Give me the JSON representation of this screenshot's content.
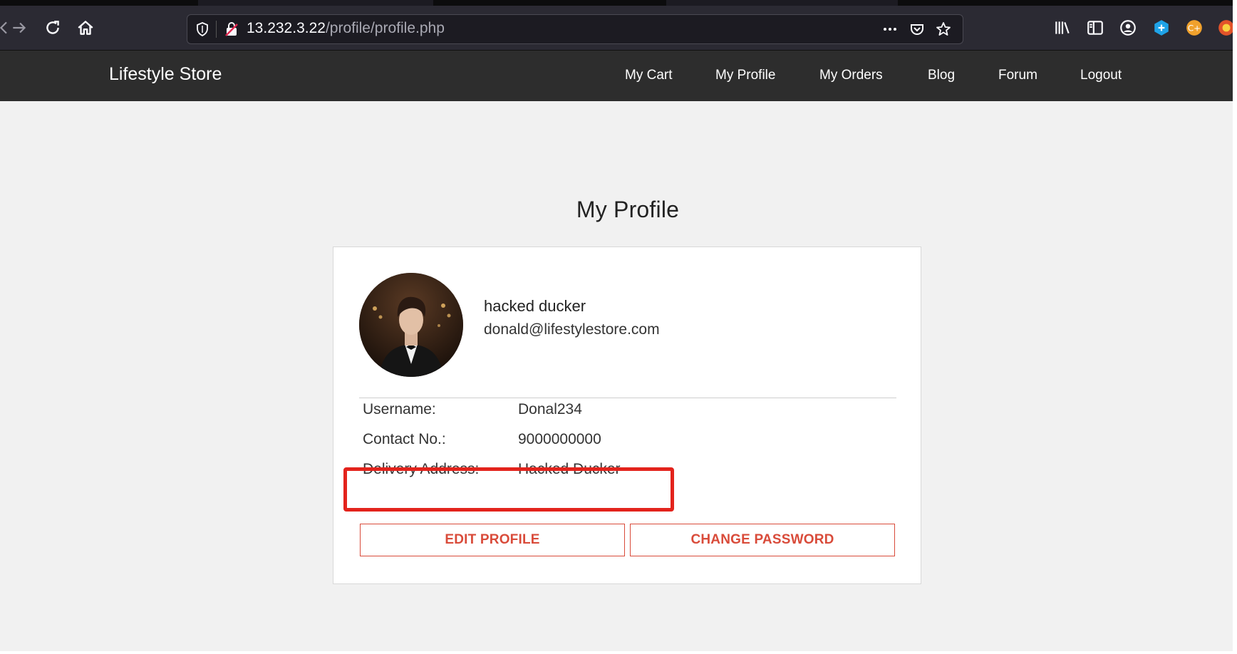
{
  "browser": {
    "url_host": "13.232.3.22",
    "url_path": "/profile/profile.php",
    "icons": [
      "back-icon",
      "forward-icon",
      "reload-icon",
      "home-icon",
      "shield-icon",
      "insecure-lock-icon",
      "more-icon",
      "pocket-icon",
      "bookmark-star-icon",
      "library-icon",
      "sidebar-icon",
      "account-icon",
      "extension-icon",
      "extension-icon",
      "extension-icon"
    ]
  },
  "site": {
    "brand": "Lifestyle Store",
    "nav": {
      "cart": "My Cart",
      "profile": "My Profile",
      "orders": "My Orders",
      "blog": "Blog",
      "forum": "Forum",
      "logout": "Logout"
    }
  },
  "profile": {
    "page_title": "My Profile",
    "full_name": "hacked ducker",
    "email": "donald@lifestylestore.com",
    "fields": {
      "username_label": "Username:",
      "username_value": "Donal234",
      "contact_label": "Contact No.:",
      "contact_value": "9000000000",
      "address_label": "Delivery Address:",
      "address_value": "Hacked Ducker"
    },
    "buttons": {
      "edit": "EDIT PROFILE",
      "change_password": "CHANGE PASSWORD"
    }
  },
  "colors": {
    "navbar": "#2d2d2d",
    "accent": "#d94b3a",
    "highlight": "#e3231c",
    "page_bg": "#f1f1f1"
  }
}
